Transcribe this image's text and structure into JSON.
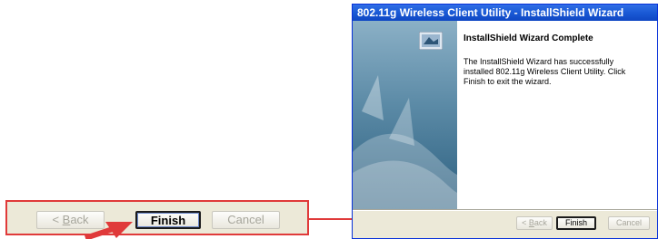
{
  "zoom": {
    "back_label_u": "B",
    "back_label_rest": "ack",
    "finish_label": "Finish",
    "cancel_label": "Cancel"
  },
  "window": {
    "title": "802.11g Wireless Client Utility - InstallShield Wizard",
    "heading": "InstallShield Wizard Complete",
    "body": "The InstallShield Wizard has successfully installed 802.11g Wireless Client Utility.  Click Finish to exit the wizard.",
    "back_label_u": "B",
    "back_label_rest": "ack",
    "finish_label": "Finish",
    "cancel_label": "Cancel"
  },
  "colors": {
    "highlight": "#e03a3a",
    "title_bar": "#1958d4",
    "dialog_bg": "#ece9d8"
  },
  "icons": [
    "left-arrow-glyph",
    "installer-icon",
    "red-pointer-arrow",
    "connector-arrow"
  ]
}
